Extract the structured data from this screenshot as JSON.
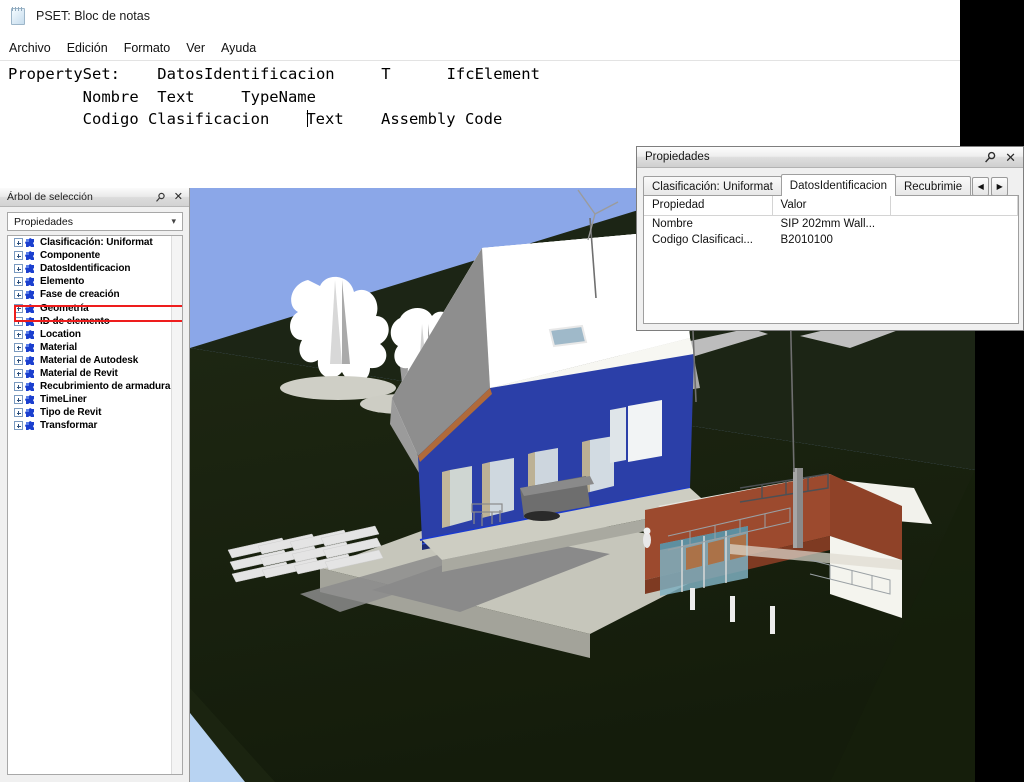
{
  "notepad": {
    "title": "PSET: Bloc de notas",
    "icon": "notepad-icon",
    "menu": [
      "Archivo",
      "Edición",
      "Formato",
      "Ver",
      "Ayuda"
    ],
    "lines": [
      "PropertySet:    DatosIdentificacion     T      IfcElement",
      "        Nombre  Text     TypeName",
      "        Codigo Clasificacion    "
    ],
    "line3_after_caret": "Text    Assembly Code",
    "caret": "text-cursor"
  },
  "tree_panel": {
    "title": "Árbol de selección",
    "pin_icon": "pin-icon",
    "close_icon": "close-icon",
    "combo": {
      "value": "Propiedades",
      "chevron": "chevron-down-icon"
    },
    "items": [
      {
        "label": "Clasificación: Uniformat"
      },
      {
        "label": "Componente"
      },
      {
        "label": "DatosIdentificacion",
        "highlighted": true
      },
      {
        "label": "Elemento"
      },
      {
        "label": "Fase de creación"
      },
      {
        "label": "Geometría"
      },
      {
        "label": "ID de elemento"
      },
      {
        "label": "Location"
      },
      {
        "label": "Material"
      },
      {
        "label": "Material de Autodesk"
      },
      {
        "label": "Material de Revit"
      },
      {
        "label": "Recubrimiento de armadura"
      },
      {
        "label": "TimeLiner"
      },
      {
        "label": "Tipo de Revit"
      },
      {
        "label": "Transformar"
      }
    ],
    "highlight_color": "#ee1d1d"
  },
  "properties_panel": {
    "title": "Propiedades",
    "pin_icon": "pin-icon",
    "close_icon": "close-icon",
    "tabs": [
      {
        "label": "Clasificación: Uniformat",
        "active": false
      },
      {
        "label": "DatosIdentificacion",
        "active": true
      },
      {
        "label": "Recubrimie",
        "active": false,
        "clipped": true
      }
    ],
    "tab_prev_icon": "arrow-left-icon",
    "tab_next_icon": "arrow-right-icon",
    "table": {
      "columns": [
        "Propiedad",
        "Valor",
        ""
      ],
      "rows": [
        [
          "Nombre",
          "SIP 202mm Wall...",
          ""
        ],
        [
          "Codigo Clasificaci...",
          "B2010100",
          ""
        ]
      ]
    }
  },
  "viewport": {
    "name": "3d-model-viewport",
    "colors": {
      "sky": "#8ba7e8",
      "sky_light": "#b8d3f2",
      "ground": "#19220f",
      "roof": "#ffffff",
      "wall_selected": "#2b3fa8",
      "annex": "#9c4a2e",
      "concrete": "#c9c9bf",
      "gray_mass": "#9a9a9a"
    },
    "objects": [
      "house",
      "trees",
      "solar-panel-array",
      "annex-building",
      "terrace",
      "terrain"
    ]
  }
}
